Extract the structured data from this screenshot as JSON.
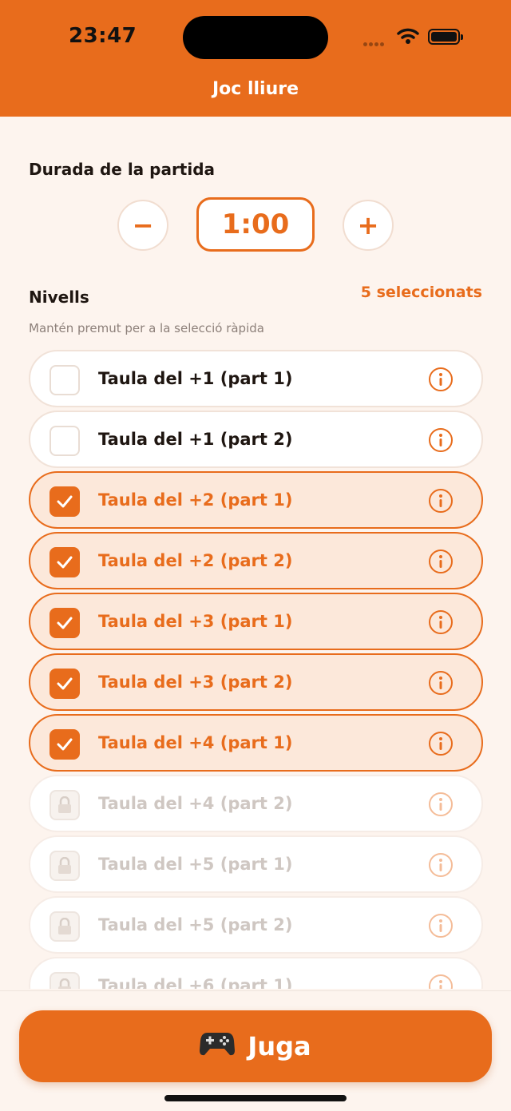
{
  "status_bar": {
    "time": "23:47"
  },
  "header": {
    "title": "Joc lliure"
  },
  "duration": {
    "label": "Durada de la partida",
    "value": "1:00",
    "minus": "−",
    "plus": "+"
  },
  "levels": {
    "label": "Nivells",
    "selected_count": "5 seleccionats",
    "hint": "Mantén premut per a la selecció ràpida",
    "items": [
      {
        "label": "Taula del +1 (part 1)",
        "state": "unchecked"
      },
      {
        "label": "Taula del +1 (part 2)",
        "state": "unchecked"
      },
      {
        "label": "Taula del +2 (part 1)",
        "state": "checked"
      },
      {
        "label": "Taula del +2 (part 2)",
        "state": "checked"
      },
      {
        "label": "Taula del +3 (part 1)",
        "state": "checked"
      },
      {
        "label": "Taula del +3 (part 2)",
        "state": "checked"
      },
      {
        "label": "Taula del +4 (part 1)",
        "state": "checked"
      },
      {
        "label": "Taula del +4 (part 2)",
        "state": "locked"
      },
      {
        "label": "Taula del +5 (part 1)",
        "state": "locked"
      },
      {
        "label": "Taula del +5 (part 2)",
        "state": "locked"
      },
      {
        "label": "Taula del +6 (part 1)",
        "state": "locked"
      }
    ]
  },
  "play_button": {
    "label": "Juga",
    "icon": "gamepad-icon"
  },
  "colors": {
    "accent": "#E86C1C",
    "background": "#FDF4EE"
  }
}
